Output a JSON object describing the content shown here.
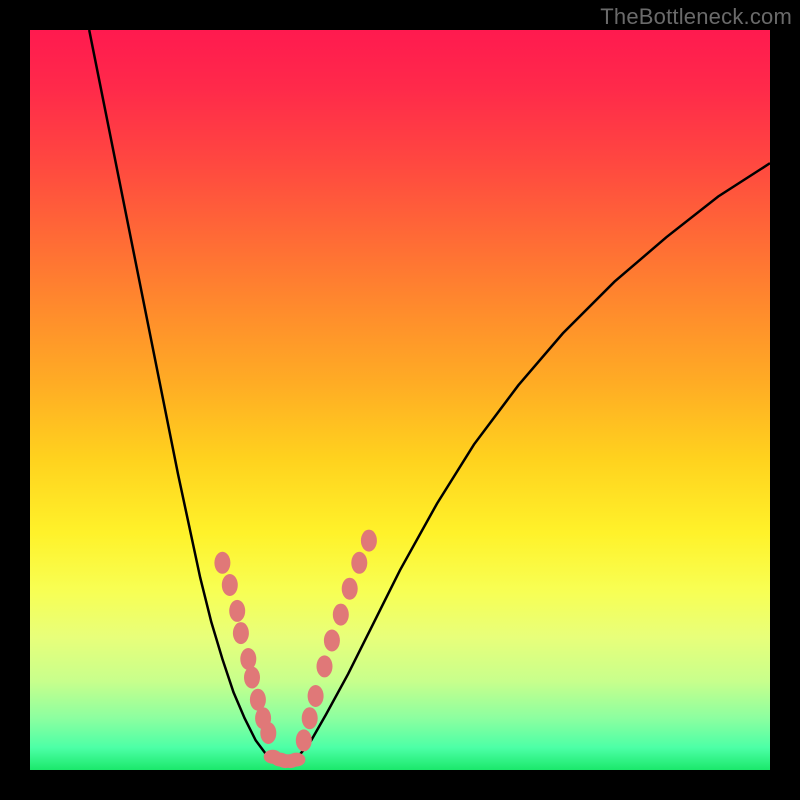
{
  "watermark": "TheBottleneck.com",
  "chart_data": {
    "type": "line",
    "title": "",
    "xlabel": "",
    "ylabel": "",
    "xlim": [
      0,
      1
    ],
    "ylim": [
      0,
      1
    ],
    "background_gradient": {
      "0": "#ff1a4f",
      "0.5": "#ffd21e",
      "0.85": "#e8ff7a",
      "1": "#1be86b"
    },
    "series": [
      {
        "name": "left-branch",
        "x": [
          0.08,
          0.1,
          0.12,
          0.14,
          0.16,
          0.18,
          0.2,
          0.215,
          0.23,
          0.245,
          0.26,
          0.275,
          0.29,
          0.305,
          0.32
        ],
        "y": [
          1.0,
          0.9,
          0.8,
          0.7,
          0.6,
          0.5,
          0.4,
          0.33,
          0.26,
          0.2,
          0.15,
          0.105,
          0.07,
          0.04,
          0.02
        ]
      },
      {
        "name": "valley",
        "x": [
          0.32,
          0.335,
          0.35,
          0.36
        ],
        "y": [
          0.02,
          0.01,
          0.01,
          0.015
        ]
      },
      {
        "name": "right-branch",
        "x": [
          0.36,
          0.38,
          0.4,
          0.43,
          0.46,
          0.5,
          0.55,
          0.6,
          0.66,
          0.72,
          0.79,
          0.86,
          0.93,
          1.0
        ],
        "y": [
          0.015,
          0.04,
          0.075,
          0.13,
          0.19,
          0.27,
          0.36,
          0.44,
          0.52,
          0.59,
          0.66,
          0.72,
          0.775,
          0.82
        ]
      }
    ],
    "markers": {
      "left_cluster": [
        {
          "x": 0.26,
          "y": 0.28
        },
        {
          "x": 0.27,
          "y": 0.25
        },
        {
          "x": 0.28,
          "y": 0.215
        },
        {
          "x": 0.285,
          "y": 0.185
        },
        {
          "x": 0.295,
          "y": 0.15
        },
        {
          "x": 0.3,
          "y": 0.125
        },
        {
          "x": 0.308,
          "y": 0.095
        },
        {
          "x": 0.315,
          "y": 0.07
        },
        {
          "x": 0.322,
          "y": 0.05
        }
      ],
      "bottom_cluster": [
        {
          "x": 0.328,
          "y": 0.018
        },
        {
          "x": 0.338,
          "y": 0.014
        },
        {
          "x": 0.345,
          "y": 0.012
        },
        {
          "x": 0.352,
          "y": 0.012
        },
        {
          "x": 0.36,
          "y": 0.014
        }
      ],
      "right_cluster": [
        {
          "x": 0.37,
          "y": 0.04
        },
        {
          "x": 0.378,
          "y": 0.07
        },
        {
          "x": 0.386,
          "y": 0.1
        },
        {
          "x": 0.398,
          "y": 0.14
        },
        {
          "x": 0.408,
          "y": 0.175
        },
        {
          "x": 0.42,
          "y": 0.21
        },
        {
          "x": 0.432,
          "y": 0.245
        },
        {
          "x": 0.445,
          "y": 0.28
        },
        {
          "x": 0.458,
          "y": 0.31
        }
      ]
    },
    "colors": {
      "curve": "#000000",
      "marker": "#e07878"
    }
  }
}
